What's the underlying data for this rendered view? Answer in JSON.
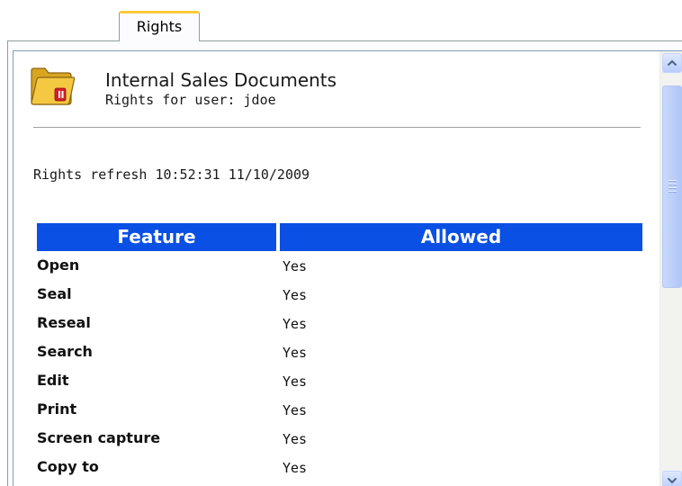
{
  "tab": {
    "label": "Rights"
  },
  "document": {
    "title": "Internal Sales Documents",
    "subtitle": "Rights for user: jdoe",
    "icon": "folder-icon"
  },
  "refresh_text": "Rights refresh 10:52:31 11/10/2009",
  "table": {
    "headers": {
      "feature": "Feature",
      "allowed": "Allowed"
    },
    "rows": [
      {
        "feature": "Open",
        "allowed": "Yes"
      },
      {
        "feature": "Seal",
        "allowed": "Yes"
      },
      {
        "feature": "Reseal",
        "allowed": "Yes"
      },
      {
        "feature": "Search",
        "allowed": "Yes"
      },
      {
        "feature": "Edit",
        "allowed": "Yes"
      },
      {
        "feature": "Print",
        "allowed": "Yes"
      },
      {
        "feature": "Screen capture",
        "allowed": "Yes"
      },
      {
        "feature": "Copy to",
        "allowed": "Yes"
      }
    ]
  },
  "colors": {
    "header_bg": "#0a50e4",
    "tab_accent": "#ffc83c",
    "folder": "#f5c842"
  }
}
